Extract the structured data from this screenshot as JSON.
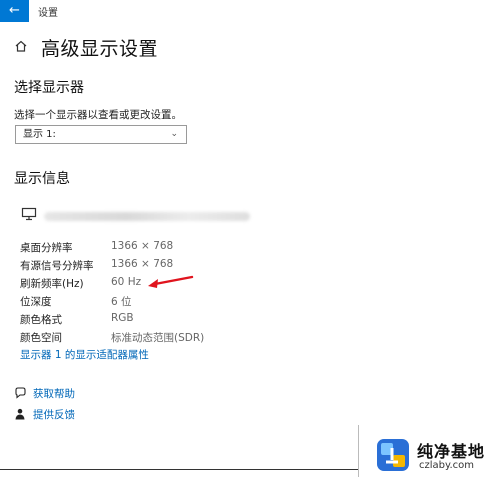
{
  "window": {
    "back_label": "←",
    "title": "设置"
  },
  "page": {
    "title": "高级显示设置"
  },
  "select_display": {
    "heading": "选择显示器",
    "description": "选择一个显示器以查看或更改设置。",
    "selected": "显示 1:"
  },
  "display_info": {
    "heading": "显示信息",
    "rows": [
      {
        "label": "桌面分辨率",
        "value": "1366 × 768"
      },
      {
        "label": "有源信号分辨率",
        "value": "1366 × 768"
      },
      {
        "label": "刷新频率(Hz)",
        "value": "60 Hz"
      },
      {
        "label": "位深度",
        "value": "6 位"
      },
      {
        "label": "颜色格式",
        "value": "RGB"
      },
      {
        "label": "颜色空间",
        "value": "标准动态范围(SDR)"
      }
    ],
    "adapter_link": "显示器 1 的显示适配器属性"
  },
  "links": {
    "help": "获取帮助",
    "feedback": "提供反馈"
  },
  "watermark": {
    "name": "纯净基地",
    "url": "czlaby.com"
  },
  "colors": {
    "accent": "#0078d4",
    "link": "#0067b8",
    "arrow": "#e0141e"
  },
  "icons": [
    "back-arrow-icon",
    "home-icon",
    "chevron-down-icon",
    "monitor-icon",
    "help-icon",
    "feedback-icon"
  ]
}
